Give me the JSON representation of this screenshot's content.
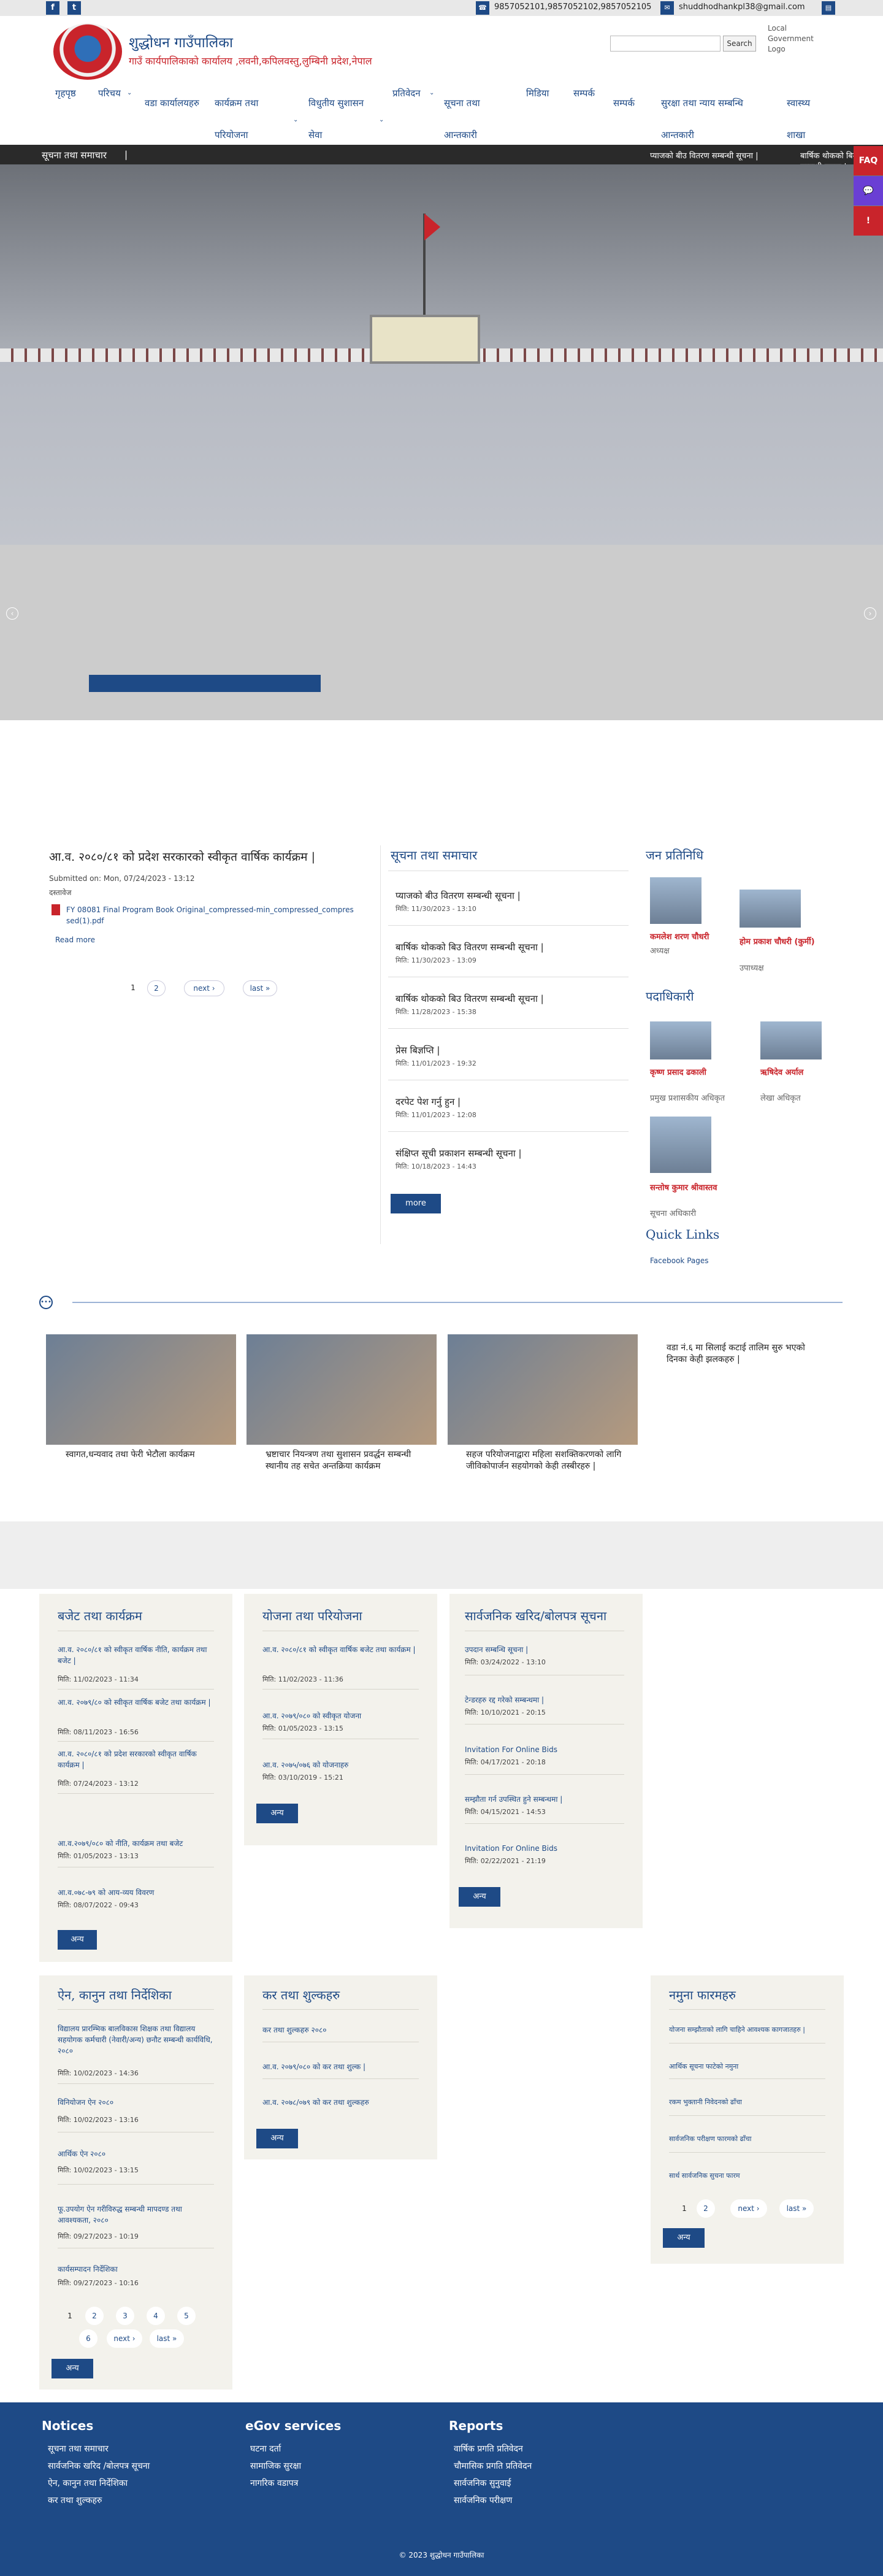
{
  "topbar": {
    "facebook_icon": "f",
    "twitter_icon": "t",
    "phone": "9857052101,9857052102,9857052105",
    "email": "shuddhodhankpl38@gmail.com"
  },
  "header": {
    "title": "शुद्धोधन गाउँपालिका",
    "subtitle": "गाउँ कार्यपालिकाको कार्यालय ,लवनी,कपिलवस्तु,लुम्बिनी प्रदेश,नेपाल",
    "search_button": "Search",
    "gov_logo_alt": "Local Government Logo"
  },
  "nav": {
    "items": [
      {
        "label": "गृहपृष्ठ"
      },
      {
        "label": "परिचय"
      },
      {
        "label": "वडा कार्यालयहरु"
      },
      {
        "label": "कार्यक्रम तथा परियोजना"
      },
      {
        "label": "विधुतीय सुशासन सेवा"
      },
      {
        "label": "प्रतिवेदन"
      },
      {
        "label": "सूचना तथा आन्तकारी"
      },
      {
        "label": "मिडिया"
      },
      {
        "label": "सम्पर्क"
      },
      {
        "label": "सम्पर्क"
      },
      {
        "label": "सुरक्षा तथा न्याय सम्बन्धि आन्तकारी"
      },
      {
        "label": "स्वास्थ्य शाखा"
      }
    ]
  },
  "ticker": {
    "label": "सूचना तथा समाचार",
    "items": [
      "प्याजको बीउ वितरण सम्बन्धी सूचना |",
      "बार्षिक थोकको बिउ वितरण सम्बन्धी सूचना |"
    ]
  },
  "side_icons": {
    "faq": "FAQ",
    "chat": "💬",
    "alert": "!"
  },
  "article": {
    "title": "आ.व. २०८०/८१ को प्रदेश सरकारको स्वीकृत वार्षिक कार्यक्रम |",
    "submitted": "Submitted on: Mon, 07/24/2023 - 13:12",
    "attachment_label": "दस्तावेज",
    "file_name": "FY 08081 Final Program Book Original_compressed-min_compressed_compressed(1).pdf",
    "read_more": "Read more",
    "pager": [
      "1",
      "2",
      "next ›",
      "last »"
    ]
  },
  "news": {
    "heading": "सूचना तथा समाचार",
    "items": [
      {
        "title": "प्याजको बीउ वितरण सम्बन्धी सूचना |",
        "date": "मिति: 11/30/2023 - 13:10"
      },
      {
        "title": "बार्षिक थोकको बिउ वितरण सम्बन्धी सूचना |",
        "date": "मिति: 11/30/2023 - 13:09"
      },
      {
        "title": "बार्षिक थोकको बिउ वितरण सम्बन्धी सूचना |",
        "date": "मिति: 11/28/2023 - 15:38"
      },
      {
        "title": "प्रेस बिज्ञप्ति |",
        "date": "मिति: 11/01/2023 - 19:32"
      },
      {
        "title": "दरपेट पेश गर्नु हुन |",
        "date": "मिति: 11/01/2023 - 12:08"
      },
      {
        "title": "संक्षिप्त सूची प्रकाशन सम्बन्धी सूचना |",
        "date": "मिति: 10/18/2023 - 14:43"
      }
    ],
    "more": "more"
  },
  "reps": {
    "heading": "जन प्रतिनिधि",
    "people": [
      {
        "name": "कमलेश शरण चौधरी",
        "role": "अध्यक्ष"
      },
      {
        "name": "होम प्रकाश चौधरी (कुर्मी)",
        "role": "उपाध्यक्ष"
      }
    ],
    "officials_heading": "पदाधिकारी",
    "officials": [
      {
        "name": "कृष्ण प्रसाद ढकाली",
        "role": "प्रमुख प्रशासकीय अधिकृत"
      },
      {
        "name": "ऋषिदेव अर्याल",
        "role": "लेखा अधिकृत"
      },
      {
        "name": "सन्तोष कुमार श्रीवास्तव",
        "role": "सूचना अधिकारी"
      }
    ],
    "quick_links_heading": "Quick Links",
    "quick_links": [
      "Facebook Pages"
    ]
  },
  "gallery": {
    "items": [
      {
        "caption": "स्वागत,धन्यवाद तथा फेरी भेटौला कार्यक्रम"
      },
      {
        "caption": "भ्रष्टाचार नियन्त्रण तथा सुशासन प्रवर्द्धन सम्बन्धी स्थानीय तह सचेत अन्तक्रिया कार्यक्रम"
      },
      {
        "caption": "सहज परियोजनाद्वारा महिला सशक्तिकरणको लागि जीविकोपार्जन सहयोगको केही तस्बीरहरु |"
      },
      {
        "caption": "वडा नं.६ मा सिलाई कटाई तालिम सुरु भएको दिनका केही झलकहरु |"
      }
    ]
  },
  "panels": {
    "budget": {
      "heading": "बजेट तथा कार्यक्रम",
      "items": [
        {
          "title": "आ.व. २०८०/८१ को स्वीकृत वार्षिक नीति, कार्यक्रम तथा बजेट |",
          "date": "मिति: 11/02/2023 - 11:34"
        },
        {
          "title": "आ.व. २०७९/८० को स्वीकृत वार्षिक बजेट तथा कार्यक्रम |",
          "date": "मिति: 08/11/2023 - 16:56"
        },
        {
          "title": "आ.व. २०८०/८१ को प्रदेश सरकारको स्वीकृत वार्षिक कार्यक्रम |",
          "date": "मिति: 07/24/2023 - 13:12"
        },
        {
          "title": "आ.व.२०७९/०८० को नीति, कार्यक्रम तथा बजेट",
          "date": "मिति: 01/05/2023 - 13:13"
        },
        {
          "title": "आ.व.०७८-७९ को आय-व्यय विवरण",
          "date": "मिति: 08/07/2022 - 09:43"
        }
      ],
      "more": "अन्य"
    },
    "projects": {
      "heading": "योजना तथा परियोजना",
      "items": [
        {
          "title": "आ.व. २०८०/८१ को स्वीकृत वार्षिक बजेट तथा कार्यक्रम |",
          "date": "मिति: 11/02/2023 - 11:36"
        },
        {
          "title": "आ.व. २०७९/०८० को स्वीकृत योजना",
          "date": "मिति: 01/05/2023 - 13:15"
        },
        {
          "title": "आ.व. २०७५/०७६ को योजनाहरु",
          "date": "मिति: 03/10/2019 - 15:21"
        }
      ],
      "more": "अन्य"
    },
    "procurement": {
      "heading": "सार्वजनिक खरिद/बोलपत्र सूचना",
      "items": [
        {
          "title": "उपदान सम्बन्धि सूचना |",
          "date": "मिति: 03/24/2022 - 13:10"
        },
        {
          "title": "टेन्डरहरु रद्द गरेको सम्बन्धमा |",
          "date": "मिति: 10/10/2021 - 20:15"
        },
        {
          "title": "Invitation For Online Bids",
          "date": "मिति: 04/17/2021 - 20:18"
        },
        {
          "title": "सम्झौता गर्न उपस्थित हुने सम्बन्धमा |",
          "date": "मिति: 04/15/2021 - 14:53"
        },
        {
          "title": "Invitation For Online Bids",
          "date": "मिति: 02/22/2021 - 21:19"
        }
      ],
      "more": "अन्य"
    },
    "acts": {
      "heading": "ऐन, कानुन तथा निर्देशिका",
      "items": [
        {
          "title": "विद्यालय प्रारम्भिक बालविकास शिक्षक तथा विद्यालय सहयोगक कर्मचारी (नेवारी/अन्य) छनौट सम्बन्धी कार्यविधि, २०८०",
          "date": "मिति: 10/02/2023 - 14:36"
        },
        {
          "title": "विनियोजन ऐन २०८०",
          "date": "मिति: 10/02/2023 - 13:16"
        },
        {
          "title": "आर्थिक ऐन २०८०",
          "date": "मिति: 10/02/2023 - 13:15"
        },
        {
          "title": "फू.उपयोग ऐन गरीविरुद्ध सम्बन्धी मापदण्ड तथा आवश्यकता, २०८०",
          "date": "मिति: 09/27/2023 - 10:19"
        },
        {
          "title": "कार्यसम्पादन निर्देशिका",
          "date": "मिति: 09/27/2023 - 10:16"
        }
      ],
      "pager": [
        "1",
        "2",
        "3",
        "4",
        "5",
        "6",
        "next ›",
        "last »"
      ],
      "more": "अन्य"
    },
    "tax": {
      "heading": "कर तथा शुल्कहरु",
      "items": [
        {
          "title": "कर तथा शुल्कहरु २०८०"
        },
        {
          "title": "आ.व. २०७९/०८० को कर तथा शुल्क |"
        },
        {
          "title": "आ.व. २०७८/०७९ को कर तथा शुल्कहरु"
        }
      ],
      "more": "अन्य"
    },
    "forms": {
      "heading": "नमुना फारमहरु",
      "items": [
        {
          "title": "योजना सम्झौताको लागि चाहिने आवश्यक कागजातहरु |"
        },
        {
          "title": "आर्थिक सूचना फाटेको नमुना"
        },
        {
          "title": "रकम भुक्तानी निवेदनको ढाँचा"
        },
        {
          "title": "सार्वजनिक परीक्षण फारमको ढाँचा"
        },
        {
          "title": "सार्थ सार्वजनिक सुचना फारम"
        }
      ],
      "pager": [
        "1",
        "2",
        "next ›",
        "last »"
      ],
      "more": "अन्य"
    }
  },
  "footer": {
    "columns": [
      {
        "heading": "Notices",
        "links": [
          "सूचना तथा समाचार",
          "सार्वजनिक खरिद /बोलपत्र सूचना",
          "ऐन, कानुन तथा निर्देशिका",
          "कर तथा शुल्कहरु"
        ]
      },
      {
        "heading": "eGov services",
        "links": [
          "घटना दर्ता",
          "सामाजिक सुरक्षा",
          "नागरिक वडापत्र"
        ]
      },
      {
        "heading": "Reports",
        "links": [
          "वार्षिक प्रगति प्रतिवेदन",
          "चौमासिक प्रगति प्रतिवेदन",
          "सार्वजनिक सुनुवाई",
          "सार्वजनिक परीक्षण"
        ]
      }
    ],
    "copyright": "© 2023 शुद्धोधन गाउँपालिका"
  }
}
